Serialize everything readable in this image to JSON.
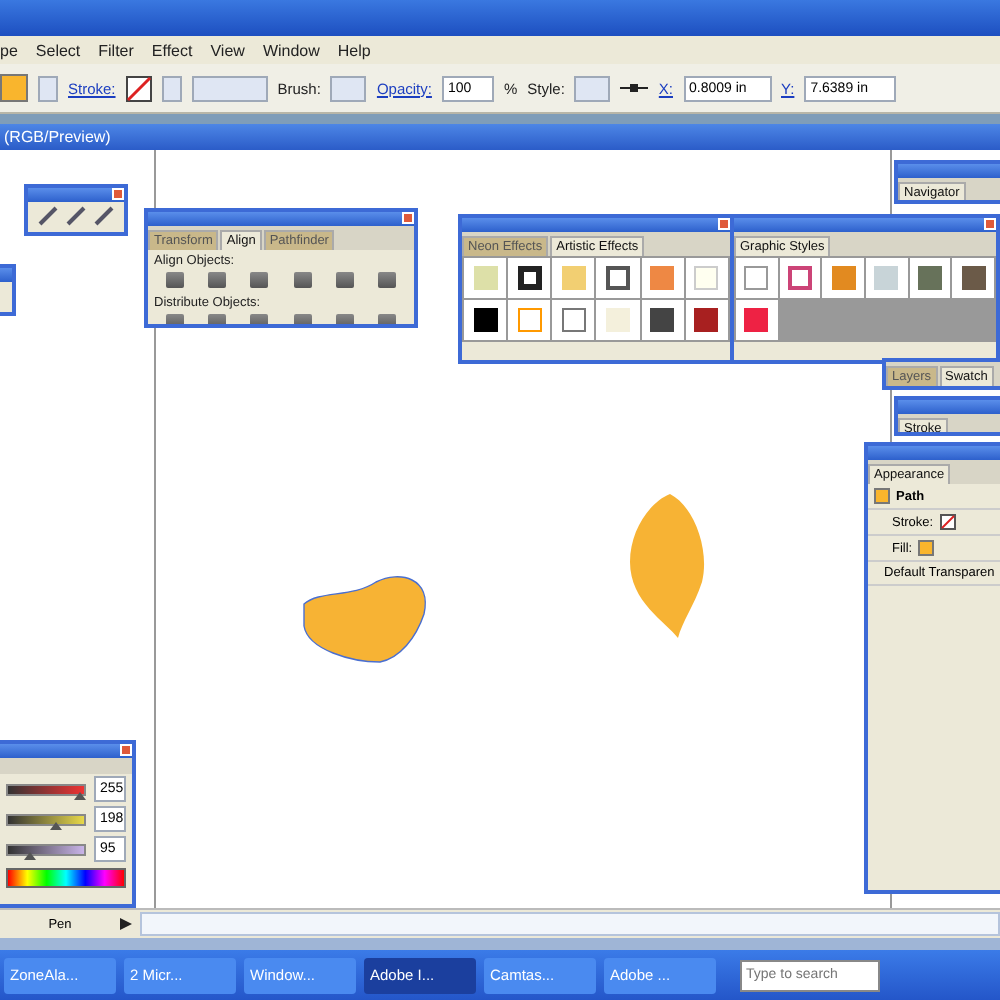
{
  "menu": [
    "pe",
    "Select",
    "Filter",
    "Effect",
    "View",
    "Window",
    "Help"
  ],
  "control_bar": {
    "stroke_label": "Stroke:",
    "brush_label": "Brush:",
    "opacity_label": "Opacity:",
    "opacity": "100",
    "percent": "%",
    "style_label": "Style:",
    "x_label": "X:",
    "x": "0.8009 in",
    "y_label": "Y:",
    "y": "7.6389 in"
  },
  "document": {
    "title": "(RGB/Preview)"
  },
  "align_panel": {
    "tabs": [
      {
        "label": "Transform",
        "selected": false
      },
      {
        "label": "Align",
        "selected": true
      },
      {
        "label": "Pathfinder",
        "selected": false
      }
    ],
    "align_label": "Align Objects:",
    "distribute_label": "Distribute Objects:"
  },
  "library_panel": {
    "tabs": [
      {
        "label": "Neon Effects",
        "selected": false
      },
      {
        "label": "Artistic Effects",
        "selected": true
      }
    ]
  },
  "styles_panel": {
    "tabs": [
      {
        "label": "Graphic Styles",
        "selected": true
      }
    ]
  },
  "navigator_panel": {
    "tabs": [
      {
        "label": "Navigator",
        "selected": true
      }
    ]
  },
  "layers_panel": {
    "tabs": [
      {
        "label": "Layers",
        "selected": false
      },
      {
        "label": "Swatch",
        "selected": true
      }
    ]
  },
  "stroke_panel": {
    "tabs": [
      {
        "label": "Stroke",
        "selected": true
      }
    ]
  },
  "appearance_panel": {
    "tab": "Appearance",
    "item": "Path",
    "rows": [
      {
        "label": "Stroke:",
        "kind": "stroke"
      },
      {
        "label": "Fill:",
        "kind": "fill"
      }
    ],
    "footer": "Default Transparen"
  },
  "color_panel": {
    "channels": [
      {
        "value": "255",
        "level": 0.95
      },
      {
        "value": "198",
        "level": 0.62
      },
      {
        "value": "95",
        "level": 0.3
      }
    ]
  },
  "status_bar": {
    "tool": "Pen"
  },
  "taskbar": {
    "buttons": [
      {
        "label": "ZoneAla...",
        "selected": false
      },
      {
        "label": "2 Micr...",
        "selected": false
      },
      {
        "label": "Window...",
        "selected": false
      },
      {
        "label": "Adobe I...",
        "selected": true
      },
      {
        "label": "Camtas...",
        "selected": false
      },
      {
        "label": "Adobe ...",
        "selected": false
      }
    ],
    "search": {
      "placeholder": "Type to search"
    }
  }
}
